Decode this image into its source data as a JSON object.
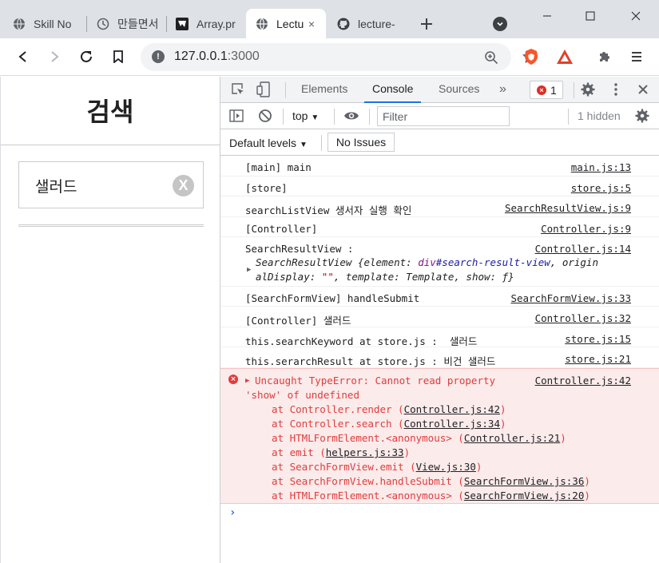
{
  "browser": {
    "tabs": [
      {
        "title": "Skill No",
        "icon": "globe-icon"
      },
      {
        "title": "만들면서",
        "icon": "clock-icon"
      },
      {
        "title": "Array.pr",
        "icon": "brand-icon"
      },
      {
        "title": "Lectu",
        "icon": "globe-icon",
        "active": true
      },
      {
        "title": "lecture-",
        "icon": "github-icon"
      }
    ],
    "tab_close_glyph": "×",
    "new_tab_glyph": "+",
    "url_host": "127.0.0.1",
    "url_port": ":3000"
  },
  "page": {
    "title": "검색",
    "search_value": "샐러드",
    "reset_glyph": "X"
  },
  "devtools": {
    "tabs": [
      "Elements",
      "Console",
      "Sources"
    ],
    "more_glyph": "»",
    "error_count": "1",
    "context": "top",
    "filter_placeholder": "Filter",
    "hidden": "1 hidden",
    "levels": "Default levels",
    "no_issues": "No Issues",
    "messages": [
      {
        "text": "[main] main",
        "src": "main.js:13"
      },
      {
        "text": "[store]",
        "src": "store.js:5"
      },
      {
        "text": "searchListView 생서자 실행 확인",
        "src": "SearchResultView.js:9"
      },
      {
        "text": "[Controller]",
        "src": "Controller.js:9"
      },
      {
        "text": "SearchResultView :",
        "src": "Controller.js:14",
        "obj_line1_a": "SearchResultView {element: ",
        "obj_line1_b": "div",
        "obj_line1_c": "#search-result-view",
        "obj_line1_d": ", origin",
        "obj_line2_a": "alDisplay: ",
        "obj_line2_b": "\"\"",
        "obj_line2_c": ", template: Template, show: ƒ}"
      },
      {
        "text": "[SearchFormView] handleSubmit",
        "src": "SearchFormView.js:33"
      },
      {
        "text": "[Controller] 샐러드",
        "src": "Controller.js:32"
      },
      {
        "text": "this.searchKeyword at store.js :  샐러드",
        "src": "store.js:15"
      },
      {
        "text": "this.serarchResult at store.js : 비건 샐러드",
        "src": "store.js:21"
      }
    ],
    "error": {
      "line1": "Uncaught TypeError: Cannot read property",
      "line2": "'show' of undefined",
      "src": "Controller.js:42",
      "stack": [
        {
          "fn": "at Controller.render (",
          "file": "Controller.js:42"
        },
        {
          "fn": "at Controller.search (",
          "file": "Controller.js:34"
        },
        {
          "fn": "at HTMLFormElement.<anonymous> (",
          "file": "Controller.js:21"
        },
        {
          "fn": "at emit (",
          "file": "helpers.js:33"
        },
        {
          "fn": "at SearchFormView.emit (",
          "file": "View.js:30"
        },
        {
          "fn": "at SearchFormView.handleSubmit (",
          "file": "SearchFormView.js:36"
        },
        {
          "fn": "at HTMLFormElement.<anonymous> (",
          "file": "SearchFormView.js:20"
        }
      ]
    },
    "prompt_glyph": "›"
  }
}
